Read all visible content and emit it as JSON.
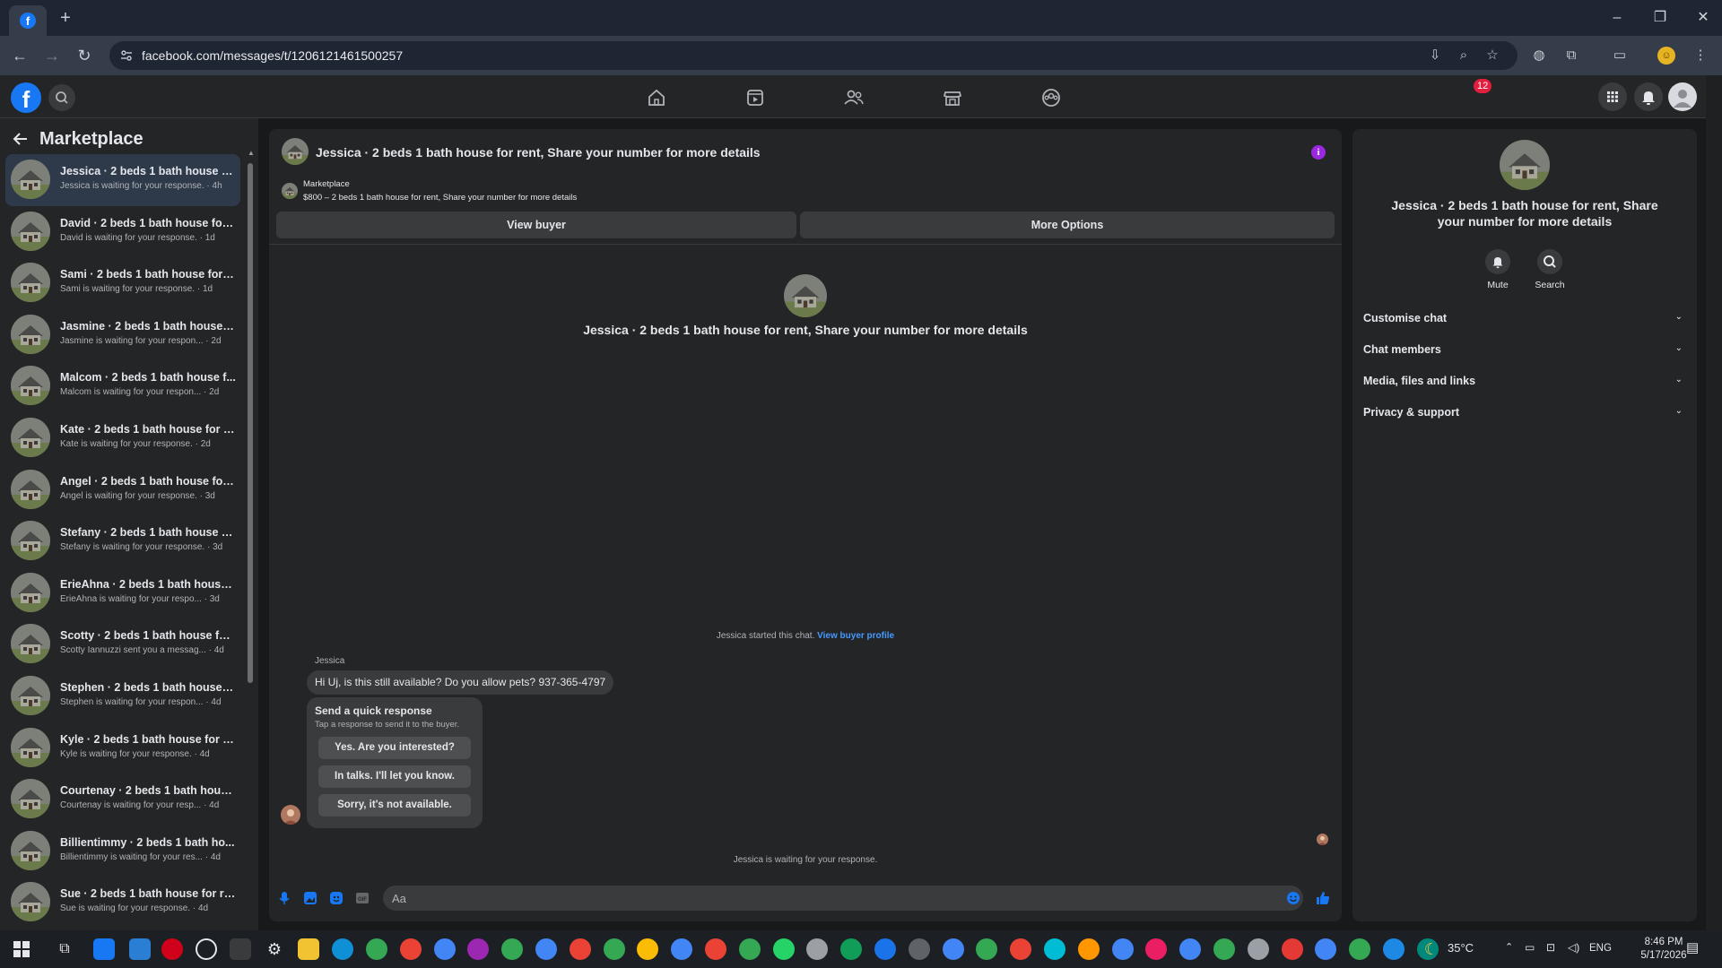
{
  "browser": {
    "url": "facebook.com/messages/t/1206121461500257",
    "new_tab": "+",
    "win_min": "–",
    "win_max": "❐",
    "win_close": "✕"
  },
  "fbnav": {
    "notifications_count": "12"
  },
  "sidebar": {
    "title": "Marketplace",
    "conversations": [
      {
        "title": "Jessica · 2 beds 1 bath house for...",
        "sub": "Jessica is waiting for your response. · 4h"
      },
      {
        "title": "David · 2 beds 1 bath house for ...",
        "sub": "David is waiting for your response. · 1d"
      },
      {
        "title": "Sami · 2 beds 1 bath house for r...",
        "sub": "Sami is waiting for your response. · 1d"
      },
      {
        "title": "Jasmine · 2 beds 1 bath house f...",
        "sub": "Jasmine is waiting for your respon... · 2d"
      },
      {
        "title": "Malcom · 2 beds 1 bath house f...",
        "sub": "Malcom is waiting for your respon... · 2d"
      },
      {
        "title": "Kate · 2 beds 1 bath house for r...",
        "sub": "Kate is waiting for your response. · 2d"
      },
      {
        "title": "Angel · 2 beds 1 bath house for ...",
        "sub": "Angel is waiting for your response. · 3d"
      },
      {
        "title": "Stefany · 2 beds 1 bath house fo...",
        "sub": "Stefany is waiting for your response. · 3d"
      },
      {
        "title": "ErieAhna · 2 beds 1 bath house f...",
        "sub": "ErieAhna is waiting for your respo... · 3d"
      },
      {
        "title": "Scotty · 2 beds 1 bath house for...",
        "sub": "Scotty Iannuzzi sent you a messag... · 4d"
      },
      {
        "title": "Stephen · 2 beds 1 bath house f...",
        "sub": "Stephen is waiting for your respon... · 4d"
      },
      {
        "title": "Kyle · 2 beds 1 bath house for re...",
        "sub": "Kyle is waiting for your response. · 4d"
      },
      {
        "title": "Courtenay · 2 beds 1 bath hous...",
        "sub": "Courtenay is waiting for your resp... · 4d"
      },
      {
        "title": "Billientimmy · 2 beds 1 bath ho...",
        "sub": "Billientimmy is waiting for your res... · 4d"
      },
      {
        "title": "Sue · 2 beds 1 bath house for re...",
        "sub": "Sue is waiting for your response. · 4d"
      }
    ]
  },
  "chat": {
    "header_title": "Jessica · 2 beds 1 bath house for rent, Share your number for more details",
    "marketplace_label": "Marketplace",
    "listing_line": "$800 – 2 beds 1 bath house for rent, Share your number for more details",
    "view_buyer": "View buyer",
    "more_options": "More Options",
    "center_title": "Jessica · 2 beds 1 bath house for rent, Share your number for more details",
    "started_text": "Jessica started this chat. ",
    "view_buyer_profile": "View buyer profile",
    "sender_name": "Jessica",
    "message": "Hi Uj, is this still available? Do you allow pets? 937-365-4797",
    "quick_title": "Send a quick response",
    "quick_sub": "Tap a response to send it to the buyer.",
    "quick_options": [
      "Yes. Are you interested?",
      "In talks. I'll let you know.",
      "Sorry, it's not available."
    ],
    "waiting_text": "Jessica is waiting for your response.",
    "input_placeholder": "Aa"
  },
  "right_panel": {
    "title": "Jessica · 2 beds 1 bath house for rent, Share your number for more details",
    "mute": "Mute",
    "search": "Search",
    "sections": [
      "Customise chat",
      "Chat members",
      "Media, files and links",
      "Privacy & support"
    ]
  },
  "taskbar": {
    "weather": "35°C",
    "language": "ENG",
    "time": "8:46 PM",
    "date": "5/17/2026"
  },
  "colors": {
    "accent": "#1877f2",
    "link": "#4599ff",
    "info": "#9b28e0",
    "badge": "#e41e3f"
  }
}
